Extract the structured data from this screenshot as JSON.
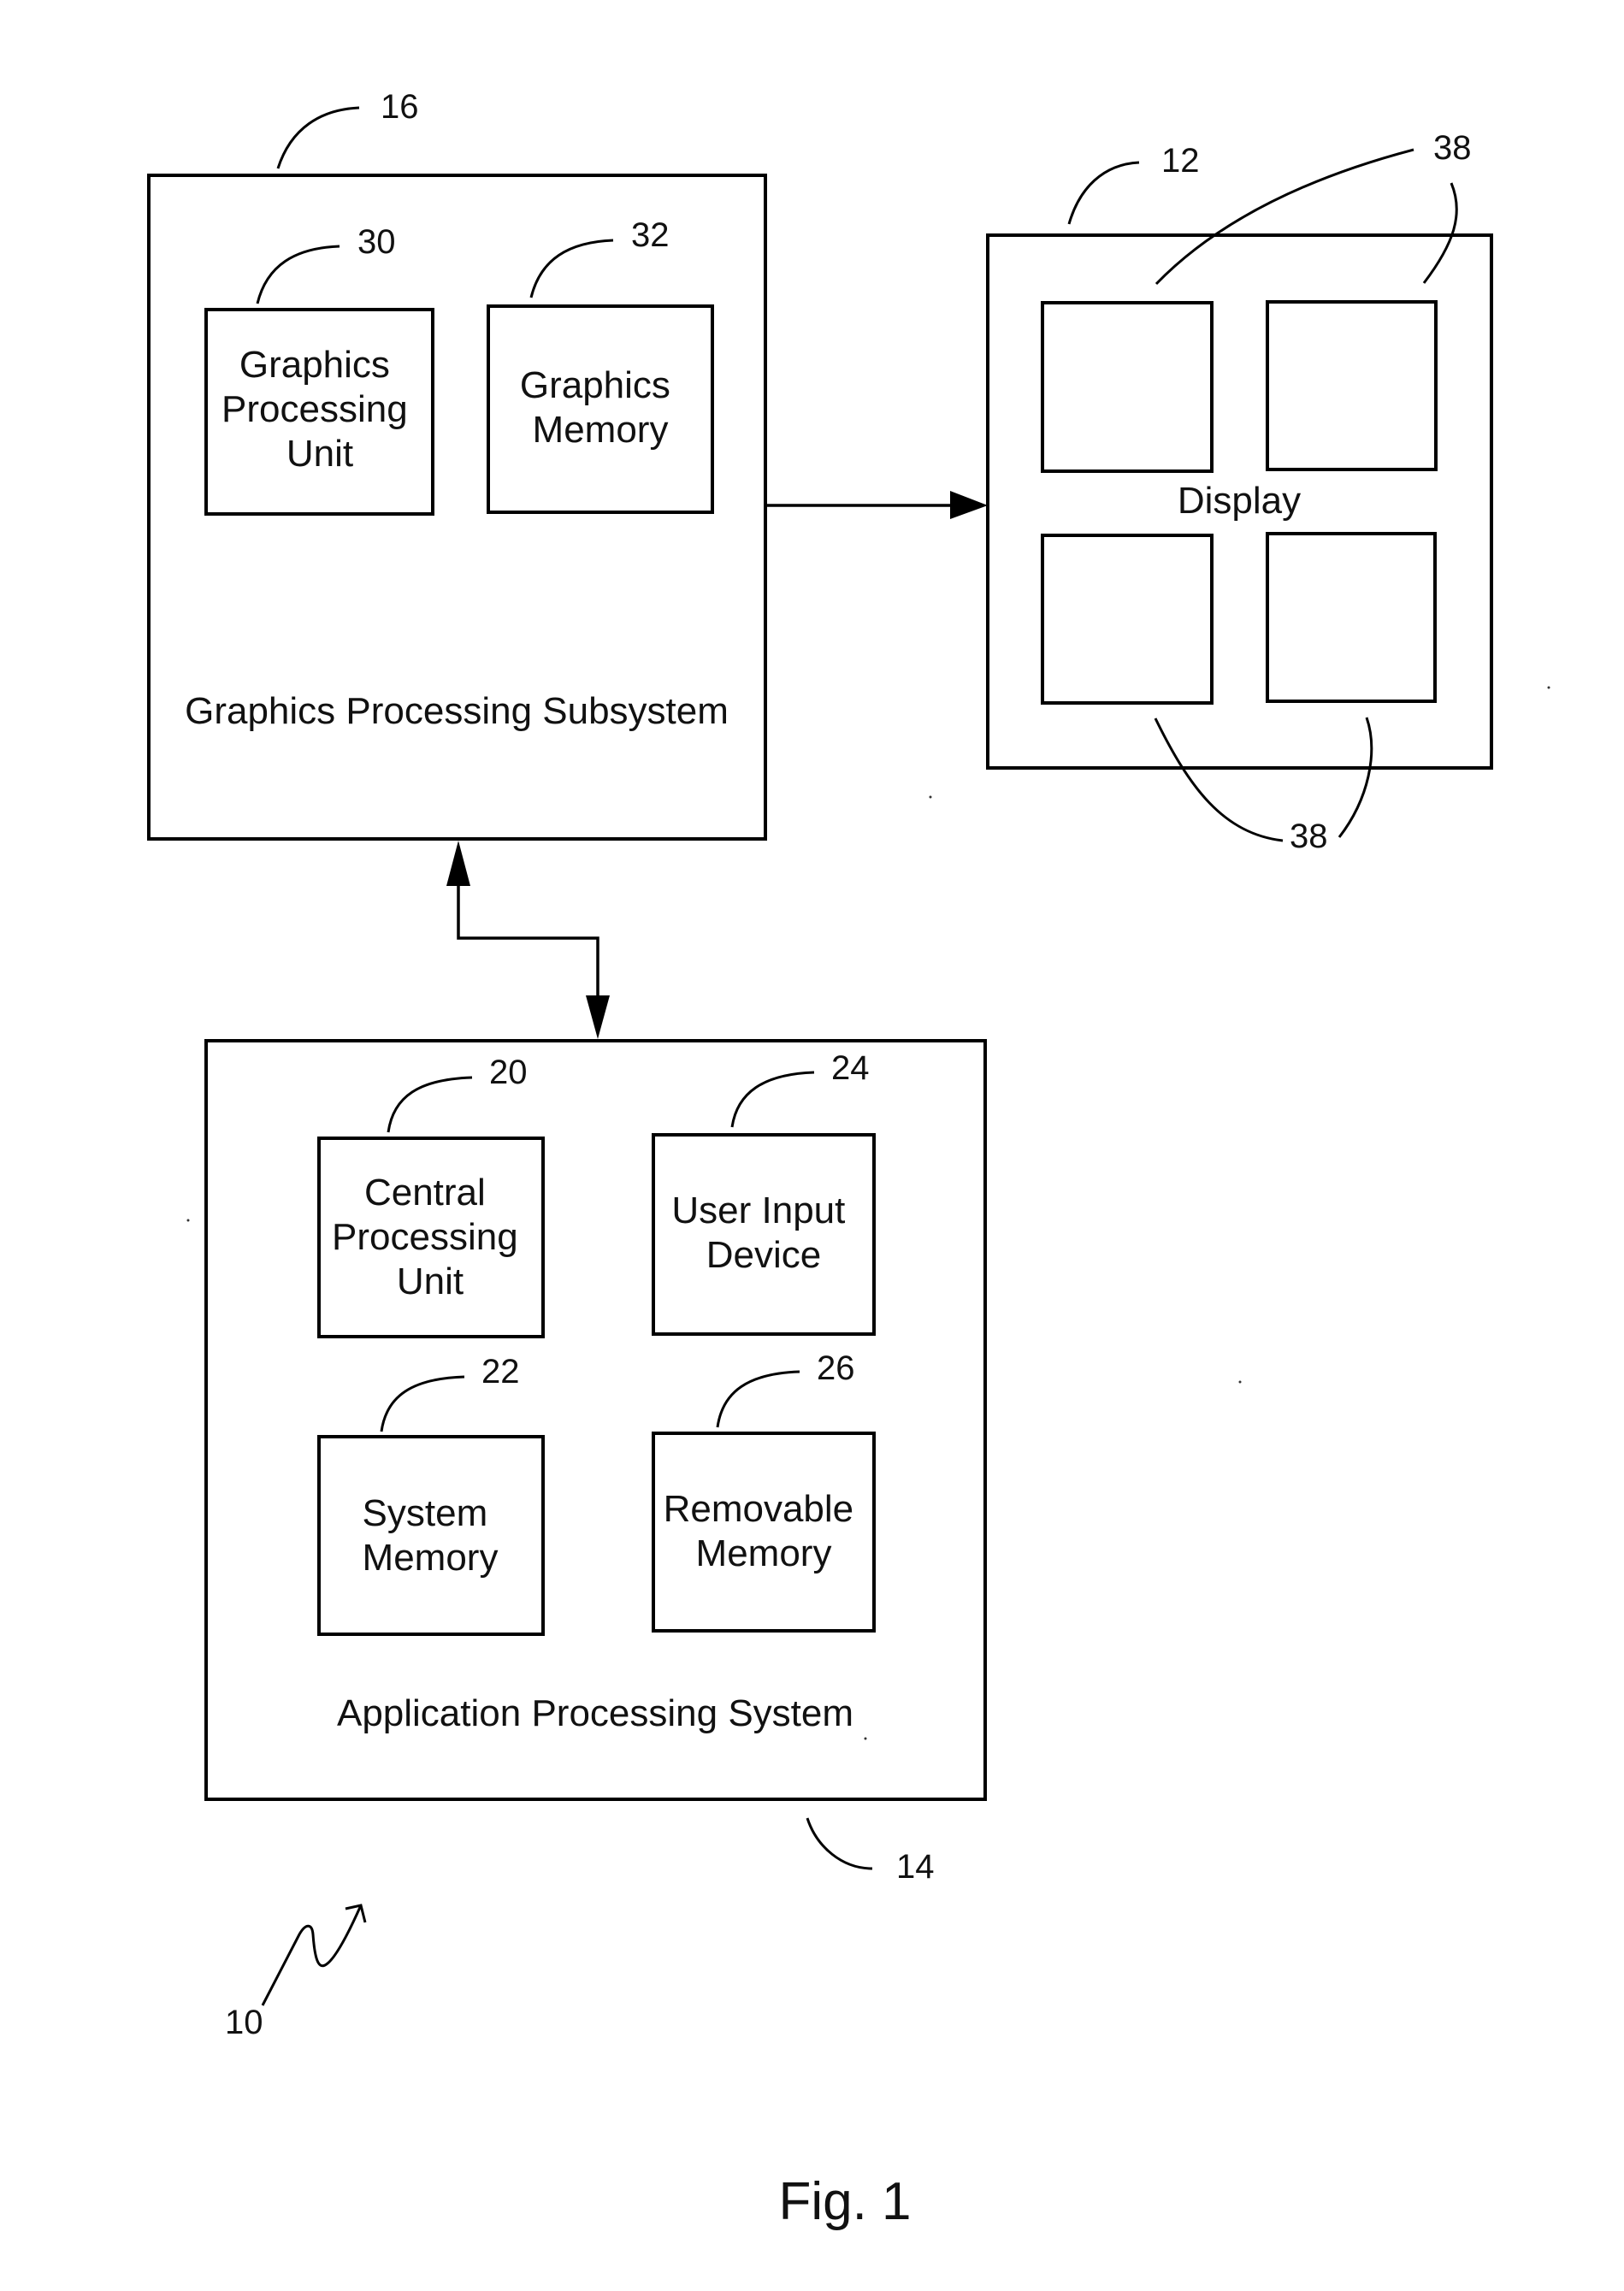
{
  "figure": {
    "caption": "Fig. 1",
    "system_ref": "10"
  },
  "graphics_subsystem": {
    "ref": "16",
    "label": "Graphics Processing Subsystem",
    "gpu": {
      "ref": "30",
      "lines": [
        "Graphics",
        "Processing",
        "Unit"
      ]
    },
    "memory": {
      "ref": "32",
      "lines": [
        "Graphics",
        "Memory"
      ]
    }
  },
  "display": {
    "ref": "12",
    "label": "Display",
    "region_ref": "38"
  },
  "application_system": {
    "ref": "14",
    "label": "Application Processing System",
    "cpu": {
      "ref": "20",
      "lines": [
        "Central",
        "Processing",
        "Unit"
      ]
    },
    "user_input": {
      "ref": "24",
      "lines": [
        "User Input",
        "Device"
      ]
    },
    "system_memory": {
      "ref": "22",
      "lines": [
        "System",
        "Memory"
      ]
    },
    "removable_memory": {
      "ref": "26",
      "lines": [
        "Removable",
        "Memory"
      ]
    }
  },
  "connections": [
    {
      "from": "Graphics Processing Subsystem",
      "to": "Display",
      "direction": "one-way"
    },
    {
      "from": "Graphics Processing Subsystem",
      "to": "Application Processing System",
      "direction": "two-way"
    }
  ]
}
